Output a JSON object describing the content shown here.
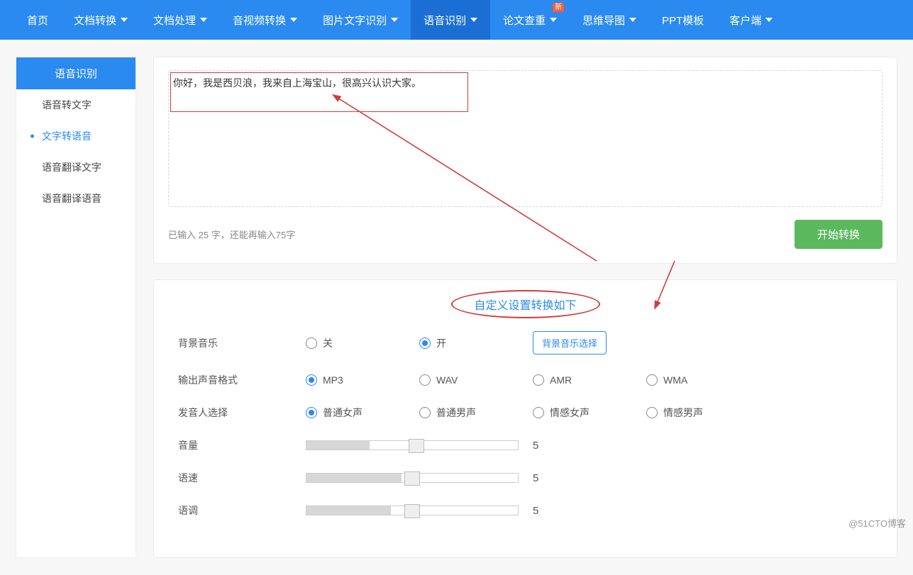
{
  "nav": {
    "items": [
      {
        "label": "首页",
        "caret": false
      },
      {
        "label": "文档转换",
        "caret": true
      },
      {
        "label": "文档处理",
        "caret": true
      },
      {
        "label": "音视频转换",
        "caret": true
      },
      {
        "label": "图片文字识别",
        "caret": true
      },
      {
        "label": "语音识别",
        "caret": true,
        "active": true
      },
      {
        "label": "论文查重",
        "caret": true,
        "badge": "新"
      },
      {
        "label": "思维导图",
        "caret": true
      },
      {
        "label": "PPT模板",
        "caret": false
      },
      {
        "label": "客户端",
        "caret": true
      }
    ]
  },
  "sidebar": {
    "title": "语音识别",
    "items": [
      {
        "label": "语音转文字"
      },
      {
        "label": "文字转语音",
        "active": true
      },
      {
        "label": "语音翻译文字"
      },
      {
        "label": "语音翻译语音"
      }
    ]
  },
  "input": {
    "text": "你好，我是西贝浪，我来自上海宝山，很高兴认识大家。",
    "typed": 25,
    "remain": 75,
    "counter_prefix": "已输入 ",
    "counter_mid": " 字，还能再输入",
    "counter_suffix": "字",
    "convert_label": "开始转换"
  },
  "settings": {
    "title": "自定义设置转换如下",
    "bg": {
      "label": "背景音乐",
      "options": [
        "关",
        "开"
      ],
      "selected": 1,
      "chooser": "背景音乐选择"
    },
    "format": {
      "label": "输出声音格式",
      "options": [
        "MP3",
        "WAV",
        "AMR",
        "WMA"
      ],
      "selected": 0
    },
    "voice": {
      "label": "发音人选择",
      "options": [
        "普通女声",
        "普通男声",
        "情感女声",
        "情感男声"
      ],
      "selected": 0
    },
    "volume": {
      "label": "音量",
      "value": 5,
      "max": 10
    },
    "speed": {
      "label": "语速",
      "value": 5,
      "max": 10
    },
    "pitch": {
      "label": "语调",
      "value": 5,
      "max": 10
    }
  },
  "watermark": "@51CTO博客"
}
